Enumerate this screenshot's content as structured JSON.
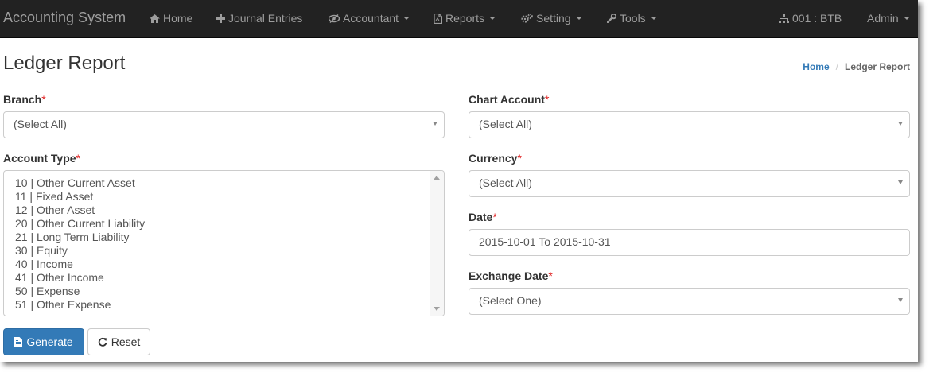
{
  "navbar": {
    "brand": "Accounting System",
    "home": "Home",
    "journal": "Journal Entries",
    "accountant": "Accountant",
    "reports": "Reports",
    "setting": "Setting",
    "tools": "Tools",
    "branch": "001 : BTB",
    "user": "Admin"
  },
  "page": {
    "title": "Ledger Report",
    "breadcrumb": {
      "home": "Home",
      "separator": "/",
      "current": "Ledger Report"
    }
  },
  "form": {
    "branch": {
      "label": "Branch",
      "value": "(Select All)"
    },
    "account_type": {
      "label": "Account Type",
      "options": [
        "10 | Other Current Asset",
        "11 | Fixed Asset",
        "12 | Other Asset",
        "20 | Other Current Liability",
        "21 | Long Term Liability",
        "30 | Equity",
        "40 | Income",
        "41 | Other Income",
        "50 | Expense",
        "51 | Other Expense"
      ]
    },
    "chart_account": {
      "label": "Chart Account",
      "value": "(Select All)"
    },
    "currency": {
      "label": "Currency",
      "value": "(Select All)"
    },
    "date": {
      "label": "Date",
      "value": "2015-10-01 To 2015-10-31"
    },
    "exchange_date": {
      "label": "Exchange Date",
      "value": "(Select One)"
    },
    "required_mark": "*"
  },
  "buttons": {
    "generate": "Generate",
    "reset": "Reset"
  },
  "colors": {
    "navbar_bg": "#222222",
    "nav_text": "#9d9d9d",
    "primary": "#337ab7",
    "required": "#e02020"
  }
}
